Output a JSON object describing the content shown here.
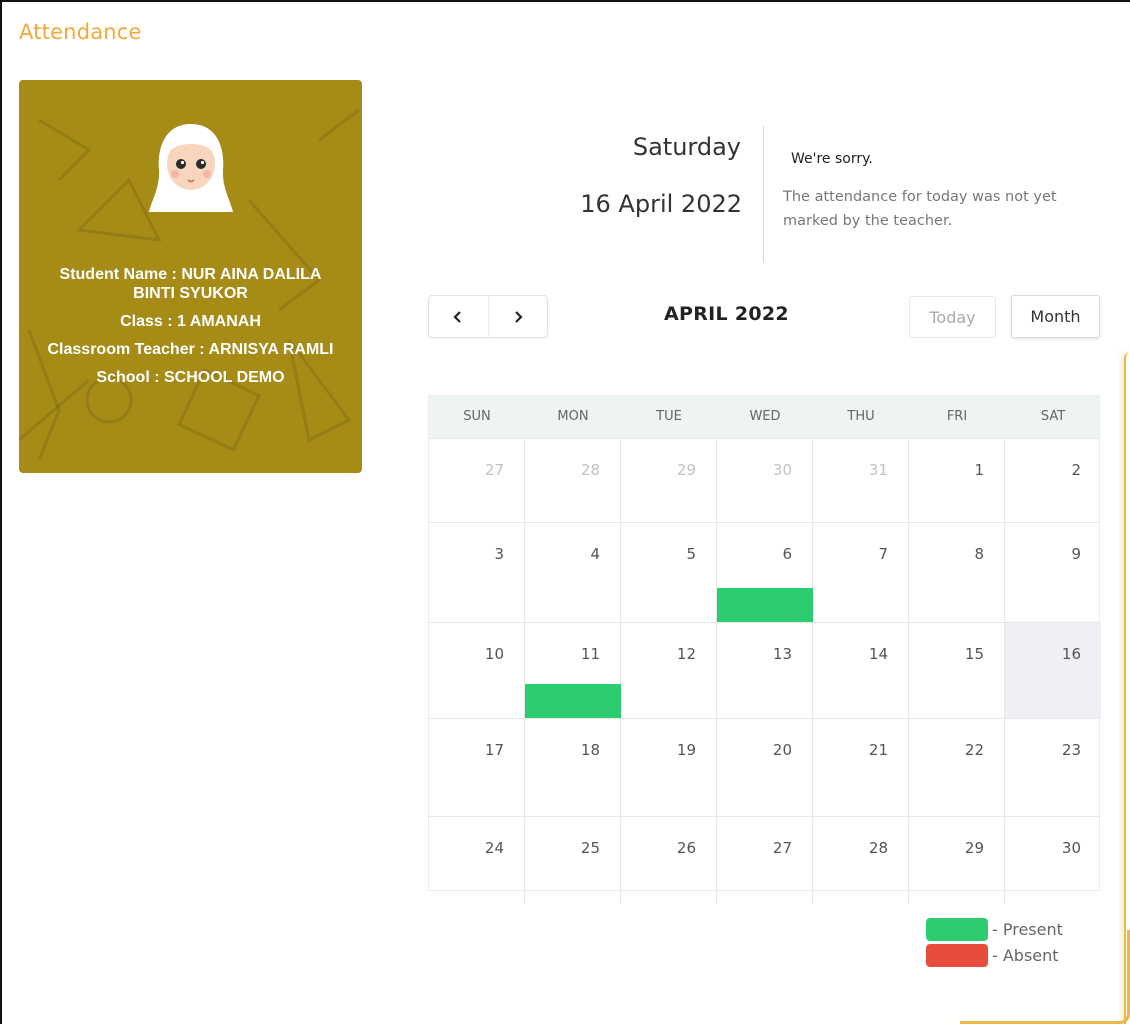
{
  "page": {
    "title": "Attendance"
  },
  "student": {
    "name_line": "Student Name : NUR AINA DALILA BINTI SYUKOR",
    "class_line": "Class : 1 AMANAH",
    "teacher_line": "Classroom Teacher : ARNISYA RAMLI",
    "school_line": "School : SCHOOL DEMO",
    "card_color": "#a68b17"
  },
  "today": {
    "day_name": "Saturday",
    "date": "16 April 2022"
  },
  "message": {
    "title": "We're sorry.",
    "body": "The attendance for today was not yet marked by the teacher."
  },
  "calendar": {
    "month_title": "APRIL 2022",
    "prev_icon": "chevron-left-icon",
    "next_icon": "chevron-right-icon",
    "today_label": "Today",
    "month_label": "Month",
    "weekdays": [
      "SUN",
      "MON",
      "TUE",
      "WED",
      "THU",
      "FRI",
      "SAT"
    ],
    "weeks": [
      [
        {
          "d": "27",
          "other": true
        },
        {
          "d": "28",
          "other": true
        },
        {
          "d": "29",
          "other": true
        },
        {
          "d": "30",
          "other": true
        },
        {
          "d": "31",
          "other": true
        },
        {
          "d": "1"
        },
        {
          "d": "2"
        }
      ],
      [
        {
          "d": "3"
        },
        {
          "d": "4"
        },
        {
          "d": "5"
        },
        {
          "d": "6",
          "present": true
        },
        {
          "d": "7"
        },
        {
          "d": "8"
        },
        {
          "d": "9"
        }
      ],
      [
        {
          "d": "10"
        },
        {
          "d": "11",
          "present": true
        },
        {
          "d": "12"
        },
        {
          "d": "13"
        },
        {
          "d": "14"
        },
        {
          "d": "15"
        },
        {
          "d": "16",
          "today": true
        }
      ],
      [
        {
          "d": "17"
        },
        {
          "d": "18"
        },
        {
          "d": "19"
        },
        {
          "d": "20"
        },
        {
          "d": "21"
        },
        {
          "d": "22"
        },
        {
          "d": "23"
        }
      ],
      [
        {
          "d": "24"
        },
        {
          "d": "25"
        },
        {
          "d": "26"
        },
        {
          "d": "27"
        },
        {
          "d": "28"
        },
        {
          "d": "29"
        },
        {
          "d": "30"
        }
      ]
    ],
    "present_color": "#2ecc71",
    "today_bg": "#eff0f3"
  },
  "legend": [
    {
      "label": "- Present",
      "color": "#2ecc71"
    },
    {
      "label": "- Absent",
      "color": "#e74c3c"
    }
  ]
}
